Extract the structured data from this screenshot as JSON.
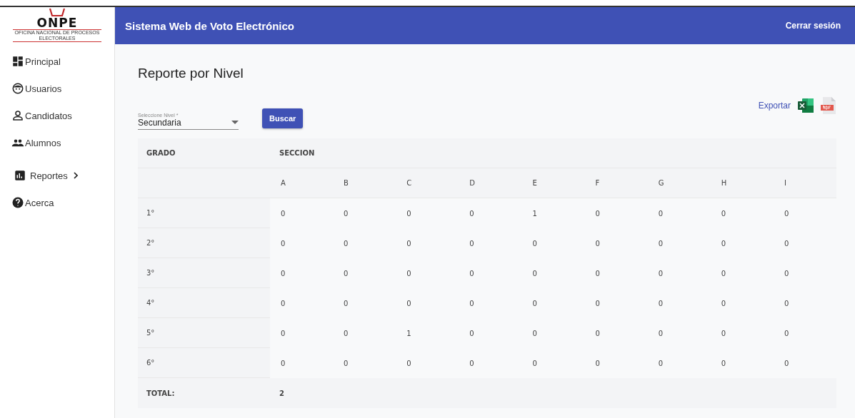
{
  "logo": {
    "name": "ONPE",
    "subtitle": "OFICINA NACIONAL DE PROCESOS ELECTORALES"
  },
  "header": {
    "title": "Sistema Web de Voto Electrónico",
    "logout": "Cerrar sesión"
  },
  "sidebar": {
    "items": [
      {
        "kind": "dashboard",
        "label": "Principal"
      },
      {
        "kind": "face",
        "label": "Usuarios"
      },
      {
        "kind": "person",
        "label": "Candidatos"
      },
      {
        "kind": "people",
        "label": "Alumnos"
      },
      {
        "kind": "chart",
        "label": "Reportes",
        "expandable": true
      },
      {
        "kind": "help",
        "label": "Acerca"
      }
    ]
  },
  "page": {
    "title": "Reporte por Nivel",
    "export_label": "Exportar",
    "level_select": {
      "label": "Seleccione Nivel *",
      "value": "Secundaria"
    },
    "search_button": "Buscar"
  },
  "table": {
    "grade_header": "GRADO",
    "section_header": "SECCION",
    "sections": [
      "A",
      "B",
      "C",
      "D",
      "E",
      "F",
      "G",
      "H",
      "I"
    ],
    "rows": [
      {
        "grade": "1°",
        "values": [
          "0",
          "0",
          "0",
          "0",
          "1",
          "0",
          "0",
          "0",
          "0"
        ]
      },
      {
        "grade": "2°",
        "values": [
          "0",
          "0",
          "0",
          "0",
          "0",
          "0",
          "0",
          "0",
          "0"
        ]
      },
      {
        "grade": "3°",
        "values": [
          "0",
          "0",
          "0",
          "0",
          "0",
          "0",
          "0",
          "0",
          "0"
        ]
      },
      {
        "grade": "4°",
        "values": [
          "0",
          "0",
          "0",
          "0",
          "0",
          "0",
          "0",
          "0",
          "0"
        ]
      },
      {
        "grade": "5°",
        "values": [
          "0",
          "0",
          "1",
          "0",
          "0",
          "0",
          "0",
          "0",
          "0"
        ]
      },
      {
        "grade": "6°",
        "values": [
          "0",
          "0",
          "0",
          "0",
          "0",
          "0",
          "0",
          "0",
          "0"
        ]
      }
    ],
    "total_label": "TOTAL:",
    "total_value": "2"
  }
}
